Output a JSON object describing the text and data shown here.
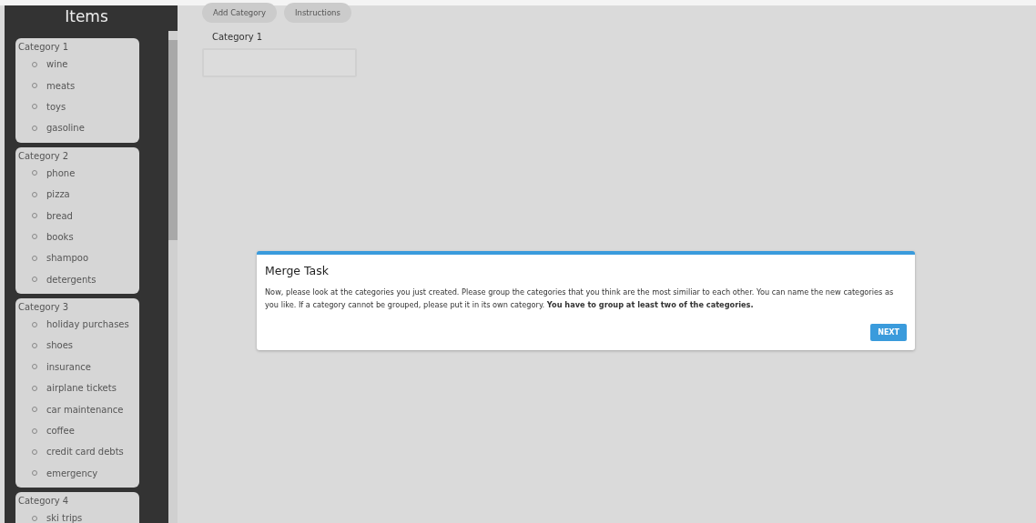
{
  "sidebar": {
    "title": "Items",
    "categories": [
      {
        "name": "Category 1",
        "items": [
          "wine",
          "meats",
          "toys",
          "gasoline"
        ]
      },
      {
        "name": "Category 2",
        "items": [
          "phone",
          "pizza",
          "bread",
          "books",
          "shampoo",
          "detergents"
        ]
      },
      {
        "name": "Category 3",
        "items": [
          "holiday purchases",
          "shoes",
          "insurance",
          "airplane tickets",
          "car maintenance",
          "coffee",
          "credit card debts",
          "emergency"
        ]
      },
      {
        "name": "Category 4",
        "items": [
          "ski trips"
        ]
      }
    ]
  },
  "toolbar": {
    "buttons": [
      "Add Category",
      "Instructions"
    ]
  },
  "workspace": {
    "categories": [
      {
        "name": "Category 1"
      }
    ]
  },
  "dialog": {
    "title": "Merge Task",
    "text": "Now, please look at the categories you just created. Please group the categories that you think are the most similiar to each other. You can name the new categories as you like. If a category cannot be grouped, please put it in its own category. **You have to group at least two of the categories.**",
    "button": "NEXT"
  }
}
